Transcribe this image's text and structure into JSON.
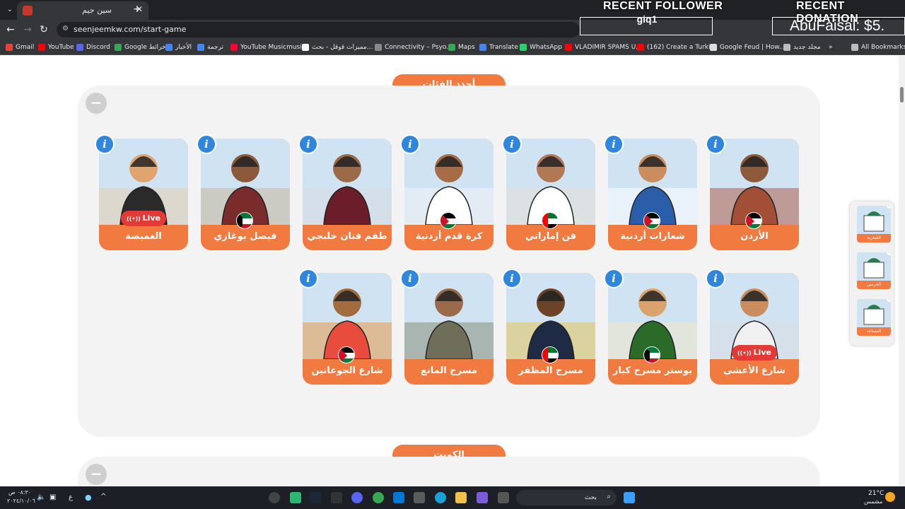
{
  "browser": {
    "tab_title": "سين جيم",
    "url": "seenjeemkw.com/start-game",
    "bookmarks": [
      {
        "label": "Gmail",
        "color": "#ea4335"
      },
      {
        "label": "YouTube",
        "color": "#ff0000"
      },
      {
        "label": "Discord",
        "color": "#5865f2"
      },
      {
        "label": "Google خرائط",
        "color": "#34a853"
      },
      {
        "label": "الأخبار",
        "color": "#4285f4"
      },
      {
        "label": "ترجمة",
        "color": "#4285f4"
      },
      {
        "label": "YouTube Musicmusi...",
        "color": "#ff0033"
      },
      {
        "label": "مميزات قوقل - بحث...",
        "color": "#ffffff"
      },
      {
        "label": "Connectivity – Psyo...",
        "color": "#888888"
      },
      {
        "label": "Maps",
        "color": "#34a853"
      },
      {
        "label": "Translate",
        "color": "#4285f4"
      },
      {
        "label": "WhatsApp",
        "color": "#25d366"
      },
      {
        "label": "VLADIMIR SPAMS U...",
        "color": "#ff0000"
      },
      {
        "label": "(162) Create a Turki...",
        "color": "#ff0000"
      },
      {
        "label": "Google Feud | How...",
        "color": "#dddddd"
      },
      {
        "label": "مجلد جديد",
        "color": "#bbbbbb"
      },
      {
        "label": "All Bookmarks",
        "color": "#bbbbbb"
      }
    ]
  },
  "overlay": {
    "follower_title": "RECENT FOLLOWER",
    "follower_name": "giq1",
    "donation_title": "RECENT DONATION",
    "donation_value": "AbuFaisal: $5."
  },
  "sections": {
    "newest": "أجدد الفئات",
    "kuwait": "الكويت",
    "collapse": "−"
  },
  "cards": [
    {
      "label": "الأردن",
      "flag": "jordan",
      "live": false,
      "bg": "#b0604a"
    },
    {
      "label": "شعارات أردنية",
      "flag": "jordan",
      "live": false,
      "bg": "#ffffff"
    },
    {
      "label": "فن إماراتي",
      "flag": "uae",
      "live": false,
      "bg": "#e8e2d6"
    },
    {
      "label": "كرة قدم أردنية",
      "flag": "jordan",
      "live": false,
      "bg": "#f4f4f4"
    },
    {
      "label": "طقم فنان خليجي",
      "flag": "",
      "live": false,
      "bg": "#d9dde2"
    },
    {
      "label": "فيصل بوغازي",
      "flag": "kuwait",
      "live": false,
      "bg": "#c9b79a"
    },
    {
      "label": "الغميضة",
      "flag": "",
      "live": true,
      "bg": "#e8cfae"
    },
    {
      "label": "شارع الأعشى",
      "flag": "",
      "live": true,
      "bg": "#dcdfe3"
    },
    {
      "label": "بوستر مسرح كبار",
      "flag": "kuwait",
      "live": false,
      "bg": "#f1e7c8"
    },
    {
      "label": "مسرح المظفر",
      "flag": "uae",
      "live": false,
      "bg": "#e3c45a"
    },
    {
      "label": "مسرح المانع",
      "flag": "",
      "live": false,
      "bg": "#8a8f7a"
    },
    {
      "label": "شارع الجوعانين",
      "flag": "jordan",
      "live": false,
      "bg": "#e79a4a"
    }
  ],
  "card_common": {
    "info": "i",
    "live_label": "Live"
  },
  "side_panel": [
    {
      "label": "القطرية"
    },
    {
      "label": "الحرمين"
    },
    {
      "label": "المساجد"
    }
  ],
  "taskbar": {
    "search_placeholder": "بحث",
    "clock_time": "٠٨:٣٠ ص",
    "clock_date": "٢٠٢٤/١٠/٠٦",
    "weather_temp": "21°C",
    "weather_desc": "مشمس",
    "lang": "ع"
  }
}
